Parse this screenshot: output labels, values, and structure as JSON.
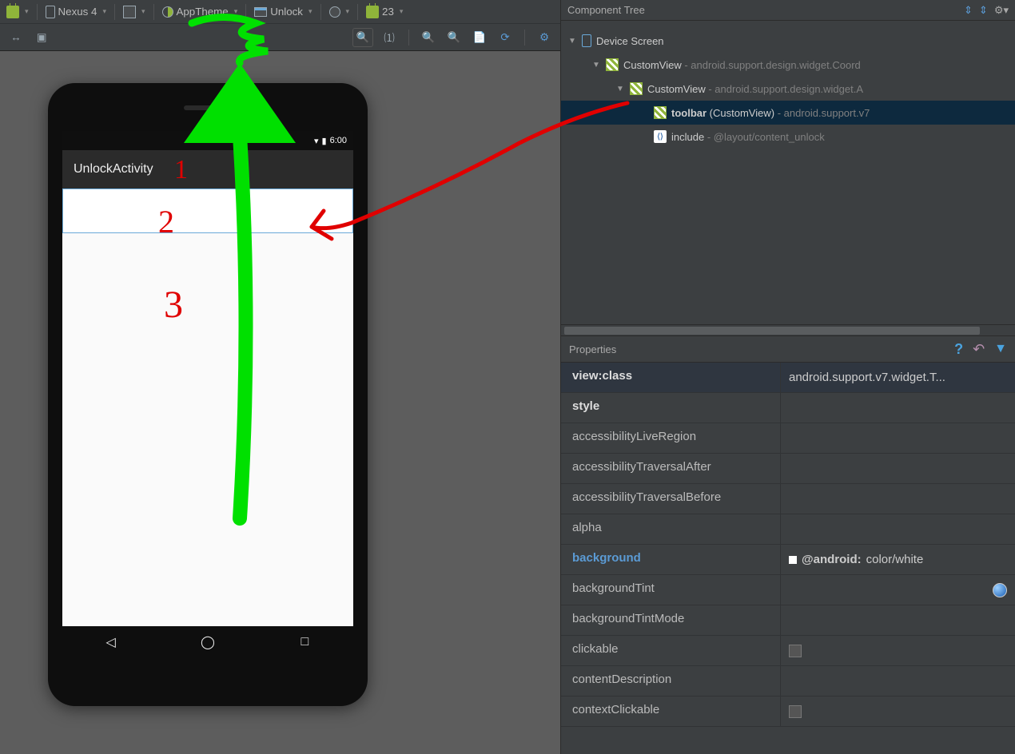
{
  "toolbar": {
    "device": "Nexus 4",
    "theme": "AppTheme",
    "layout": "Unlock",
    "api": "23"
  },
  "preview": {
    "status_time": "6:00",
    "app_title": "UnlockActivity"
  },
  "annotations": {
    "n1": "1",
    "n2": "2",
    "n3": "3"
  },
  "tree": {
    "title": "Component Tree",
    "items": [
      {
        "indent": 0,
        "expander": "▼",
        "icon": "device",
        "label": "Device Screen",
        "dim": ""
      },
      {
        "indent": 1,
        "expander": "▼",
        "icon": "hatch",
        "label": "CustomView",
        "dim": " - android.support.design.widget.Coord"
      },
      {
        "indent": 2,
        "expander": "▼",
        "icon": "hatch",
        "label": "CustomView",
        "dim": " - android.support.design.widget.A"
      },
      {
        "indent": 3,
        "expander": "",
        "icon": "hatch",
        "label_bold": "toolbar",
        "label_paren": " (CustomView)",
        "dim": " - android.support.v7",
        "selected": true
      },
      {
        "indent": 3,
        "expander": "",
        "icon": "include",
        "label": "include",
        "dim": " - @layout/content_unlock"
      }
    ]
  },
  "properties": {
    "title": "Properties",
    "rows": [
      {
        "name": "view:class",
        "bold": true,
        "head": true,
        "value": "android.support.v7.widget.T..."
      },
      {
        "name": "style",
        "bold": true,
        "value": ""
      },
      {
        "name": "accessibilityLiveRegion",
        "value": ""
      },
      {
        "name": "accessibilityTraversalAfter",
        "value": ""
      },
      {
        "name": "accessibilityTraversalBefore",
        "value": ""
      },
      {
        "name": "alpha",
        "value": ""
      },
      {
        "name": "background",
        "link": true,
        "value_pre": "@android:",
        "value_post": "color/white",
        "swatch": true
      },
      {
        "name": "backgroundTint",
        "value": "",
        "globe": true
      },
      {
        "name": "backgroundTintMode",
        "value": ""
      },
      {
        "name": "clickable",
        "value": "",
        "checkbox": true
      },
      {
        "name": "contentDescription",
        "value": ""
      },
      {
        "name": "contextClickable",
        "value": "",
        "checkbox": true
      }
    ]
  }
}
